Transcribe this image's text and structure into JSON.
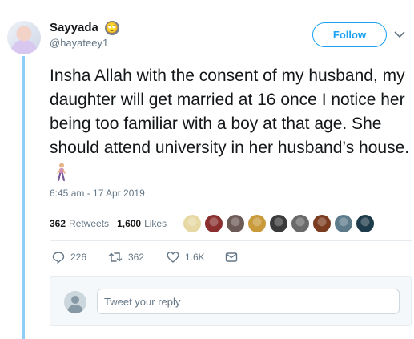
{
  "author": {
    "name": "Sayyada",
    "name_emoji": "🙄",
    "handle": "@hayateey1"
  },
  "follow_label": "Follow",
  "tweet": {
    "text": "Insha Allah with the consent of my husband, my daughter will get married at 16 once I notice her being too familiar with a boy at that age. She should attend university in her husband’s house.",
    "emoji_icon": "woman-walking-icon",
    "timestamp": "6:45 am - 17 Apr 2019"
  },
  "stats": {
    "retweets_count": "362",
    "retweets_label": "Retweets",
    "likes_count": "1,600",
    "likes_label": "Likes"
  },
  "likers": [
    {
      "color": "#e7d9a3"
    },
    {
      "color": "#8a2e2e"
    },
    {
      "color": "#6b5a55"
    },
    {
      "color": "#c89a3a"
    },
    {
      "color": "#3a3a3a"
    },
    {
      "color": "#6a6a6a"
    },
    {
      "color": "#7b3b1f"
    },
    {
      "color": "#5c7a8a"
    },
    {
      "color": "#1d3b4a"
    }
  ],
  "actions": {
    "reply_count": "226",
    "retweet_count": "362",
    "like_count": "1.6K"
  },
  "reply": {
    "placeholder": "Tweet your reply"
  },
  "colors": {
    "accent": "#1da1f2",
    "thread_line": "#8ecdf5",
    "muted_text": "#657786"
  }
}
